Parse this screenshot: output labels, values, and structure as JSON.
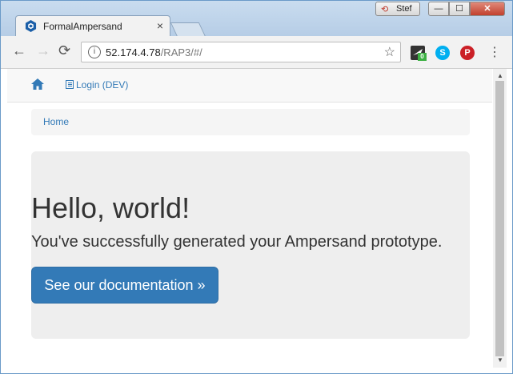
{
  "window": {
    "user_name": "Stef",
    "minimize": "—",
    "maximize": "☐",
    "close": "✕"
  },
  "tab": {
    "title": "FormalAmpersand",
    "close": "×"
  },
  "toolbar": {
    "back": "←",
    "forward": "→",
    "reload": "⟳",
    "info": "i",
    "url_host": "52.174.4.78",
    "url_path": "/RAP3/#/",
    "star": "☆",
    "ext_badge": "0",
    "menu": "⋮"
  },
  "navbar": {
    "login_label": "Login (DEV)"
  },
  "breadcrumb": {
    "home": "Home"
  },
  "jumbotron": {
    "heading": "Hello, world!",
    "text": "You've successfully generated your Ampersand prototype.",
    "button": "See our documentation »"
  },
  "colors": {
    "link": "#337ab7",
    "button": "#337ab7",
    "jumbotron_bg": "#eeeeee"
  }
}
